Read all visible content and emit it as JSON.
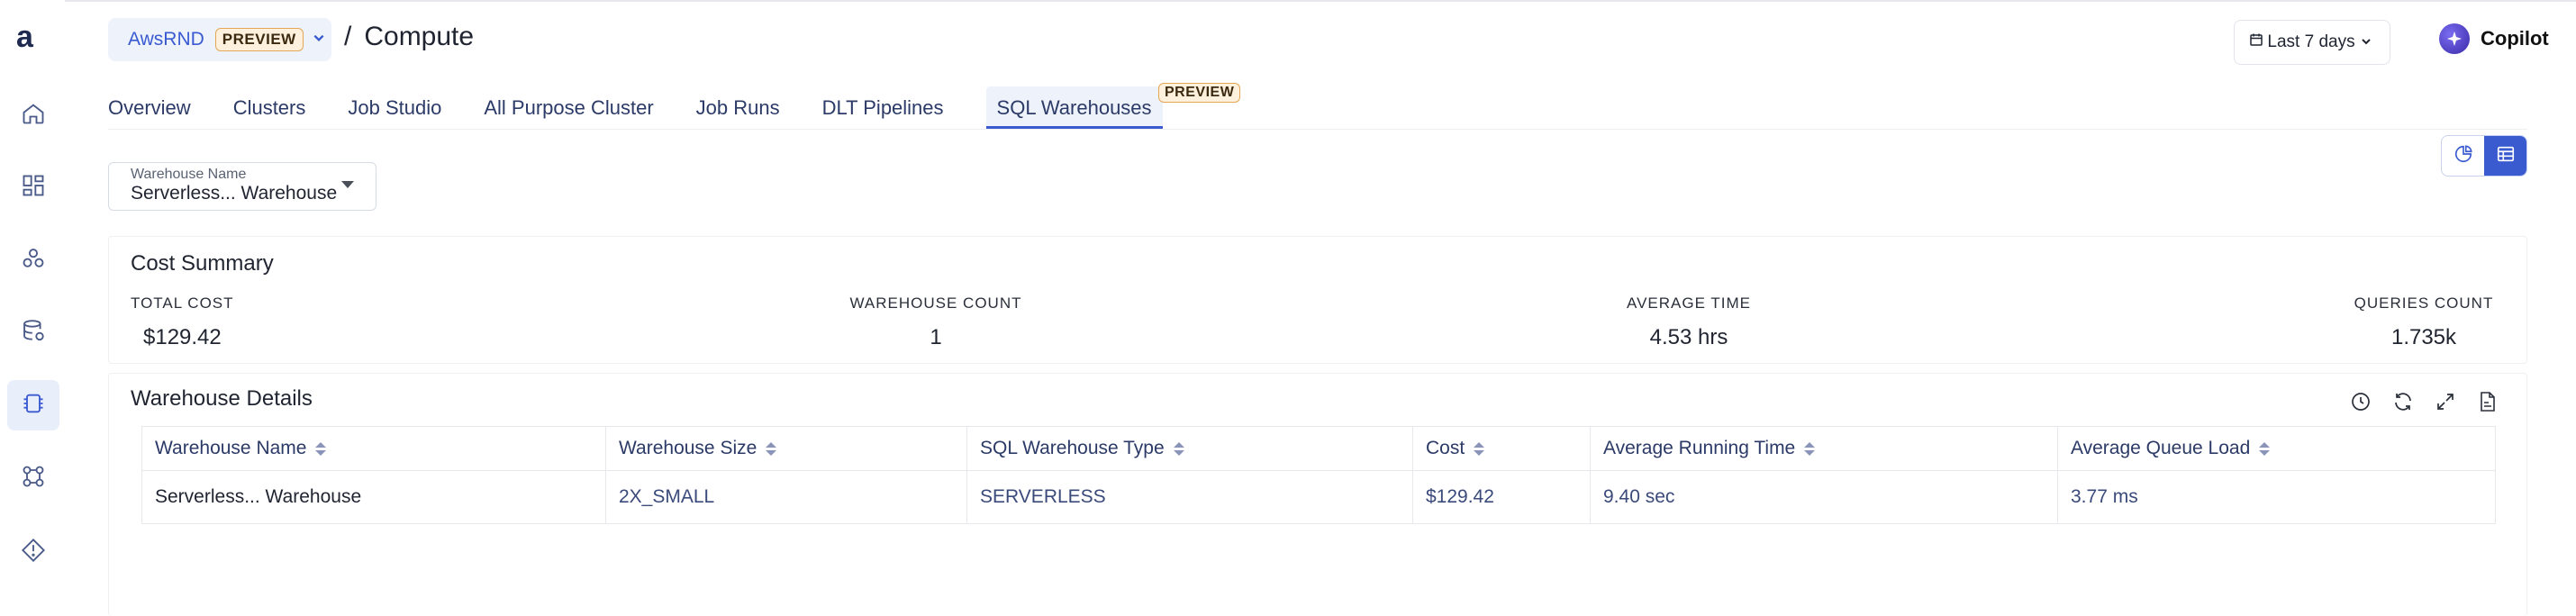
{
  "app": {
    "logo": "a"
  },
  "header": {
    "account": {
      "name": "AwsRND",
      "badge": "PREVIEW"
    },
    "breadcrumb_separator": "/",
    "page_title": "Compute",
    "date_range": "Last 7 days",
    "copilot_label": "Copilot"
  },
  "sidebar": {
    "items": [
      {
        "icon": "home-icon"
      },
      {
        "icon": "dashboard-icon"
      },
      {
        "icon": "cluster-icon"
      },
      {
        "icon": "database-icon"
      },
      {
        "icon": "chip-icon",
        "active": true
      },
      {
        "icon": "workflow-icon"
      },
      {
        "icon": "tag-icon"
      }
    ]
  },
  "tabs": [
    {
      "label": "Overview"
    },
    {
      "label": "Clusters"
    },
    {
      "label": "Job Studio"
    },
    {
      "label": "All Purpose Cluster"
    },
    {
      "label": "Job Runs"
    },
    {
      "label": "DLT Pipelines"
    },
    {
      "label": "SQL Warehouses",
      "active": true,
      "badge": "PREVIEW"
    }
  ],
  "filter": {
    "label": "Warehouse Name",
    "value": "Serverless... Warehouse"
  },
  "cost_summary": {
    "title": "Cost Summary",
    "metrics": [
      {
        "label": "TOTAL COST",
        "value": "$129.42"
      },
      {
        "label": "WAREHOUSE COUNT",
        "value": "1"
      },
      {
        "label": "AVERAGE TIME",
        "value": "4.53 hrs"
      },
      {
        "label": "QUERIES COUNT",
        "value": "1.735k"
      }
    ]
  },
  "warehouse_details": {
    "title": "Warehouse Details",
    "tools": [
      "info-icon",
      "refresh-icon",
      "expand-icon",
      "csv-export-icon"
    ],
    "columns": [
      "Warehouse Name",
      "Warehouse Size",
      "SQL Warehouse Type",
      "Cost",
      "Average Running Time",
      "Average Queue Load"
    ],
    "rows": [
      [
        "Serverless... Warehouse",
        "2X_SMALL",
        "SERVERLESS",
        "$129.42",
        "9.40 sec",
        "3.77 ms"
      ]
    ]
  },
  "colors": {
    "accent": "#3a5bd0",
    "badge_bg": "#fdf0dc",
    "badge_border": "#e3a756",
    "active_bg": "#eef2fb"
  }
}
